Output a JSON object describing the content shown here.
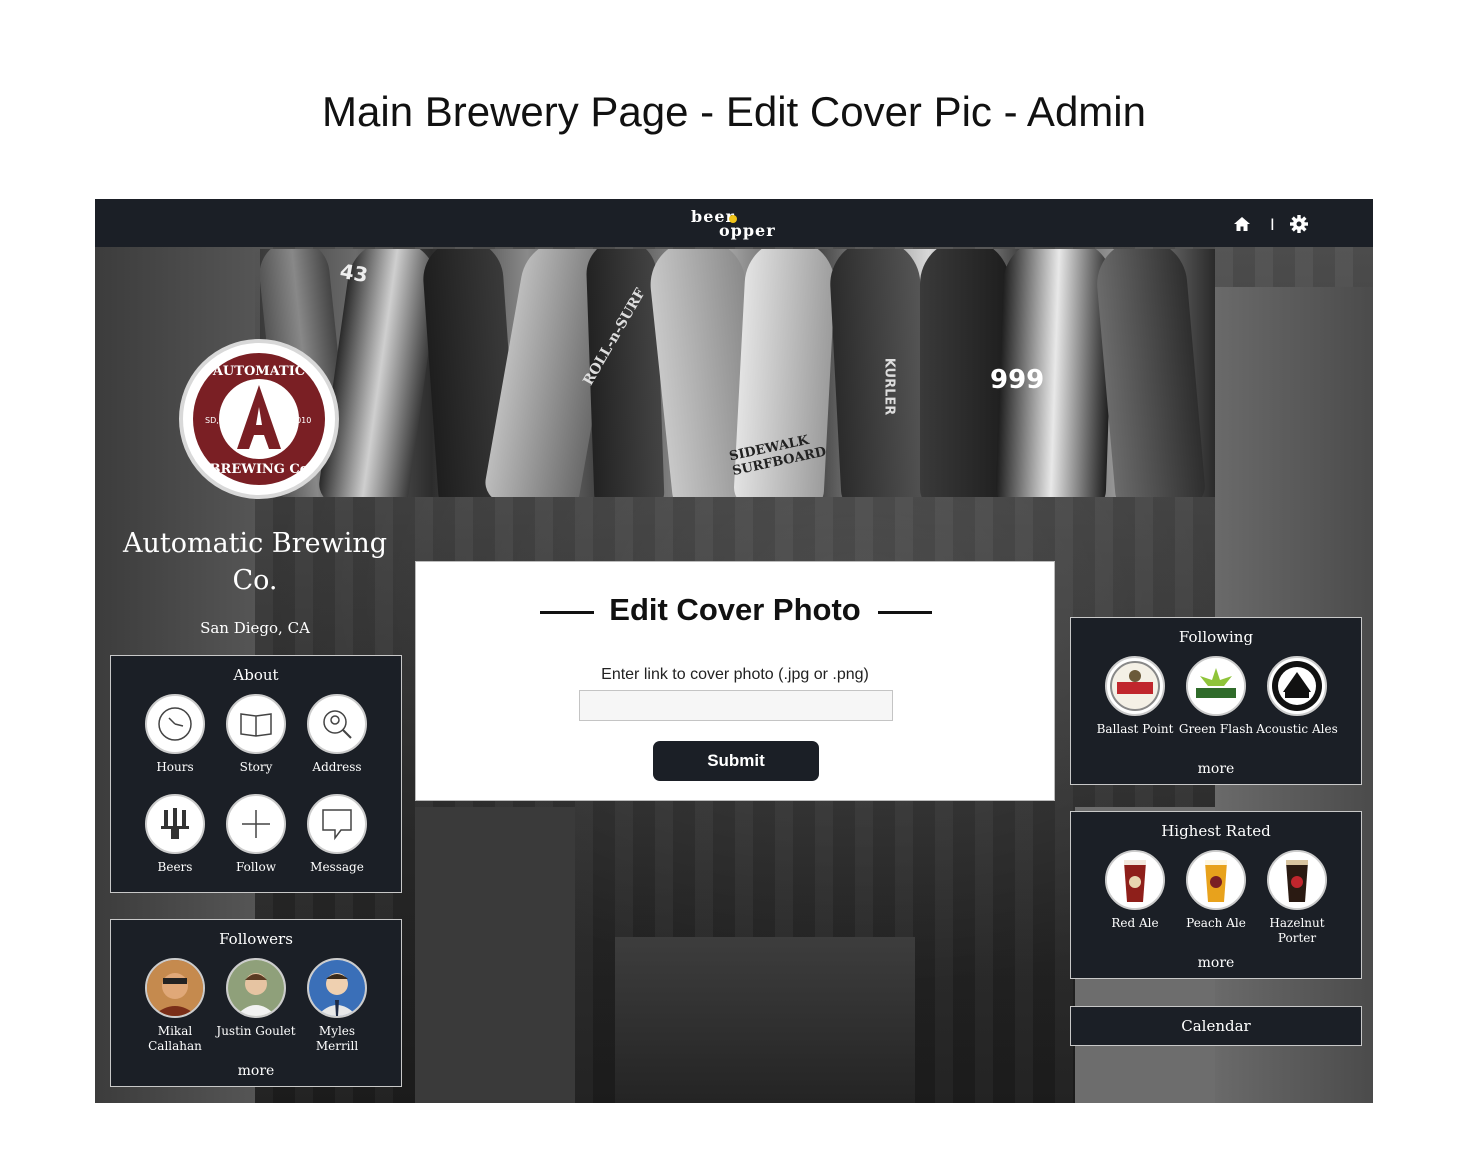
{
  "doc_title": "Main Brewery Page - Edit Cover Pic - Admin",
  "navbar": {
    "logo_line1": "beer",
    "logo_line2": "opper",
    "separator": "I",
    "home_icon": "home-icon",
    "settings_icon": "gear-icon"
  },
  "brewery": {
    "name": "Automatic Brewing Co.",
    "location": "San Diego, CA",
    "logo_text": "AUTOMATIC BREWING Co",
    "logo_left": "SD,CA",
    "logo_right": "2010",
    "logo_color": "#7a1f24"
  },
  "about": {
    "title": "About",
    "items": [
      {
        "label": "Hours",
        "icon": "clock-icon"
      },
      {
        "label": "Story",
        "icon": "book-icon"
      },
      {
        "label": "Address",
        "icon": "map-pin-icon"
      },
      {
        "label": "Beers",
        "icon": "tap-handles-icon"
      },
      {
        "label": "Follow",
        "icon": "plus-icon"
      },
      {
        "label": "Message",
        "icon": "speech-bubble-icon"
      }
    ]
  },
  "followers": {
    "title": "Followers",
    "items": [
      {
        "name": "Mikal Callahan"
      },
      {
        "name": "Justin Goulet"
      },
      {
        "name": "Myles Merrill"
      }
    ],
    "more": "more"
  },
  "modal": {
    "title": "Edit Cover Photo",
    "label": "Enter link to cover photo (.jpg or .png)",
    "input_value": "",
    "input_placeholder": "",
    "submit": "Submit"
  },
  "following": {
    "title": "Following",
    "items": [
      {
        "name": "Ballast Point"
      },
      {
        "name": "Green Flash"
      },
      {
        "name": "Acoustic Ales"
      }
    ],
    "more": "more"
  },
  "highest_rated": {
    "title": "Highest Rated",
    "items": [
      {
        "name": "Red Ale",
        "color": "#8e1f1a"
      },
      {
        "name": "Peach Ale",
        "color": "#e8a21c"
      },
      {
        "name": "Hazelnut Porter",
        "color": "#2a1a12"
      }
    ],
    "more": "more"
  },
  "calendar": {
    "label": "Calendar"
  },
  "cover": {
    "board_text_1": "43",
    "board_text_2": "999",
    "board_text_3": "SIDEWALK SURFBOARD",
    "board_text_4": "KURLER",
    "board_text_5": "ROLL-n-SURF"
  },
  "colors": {
    "navbar": "#1b1f26",
    "panel": "#1b1f26",
    "button": "#1b1f26"
  }
}
